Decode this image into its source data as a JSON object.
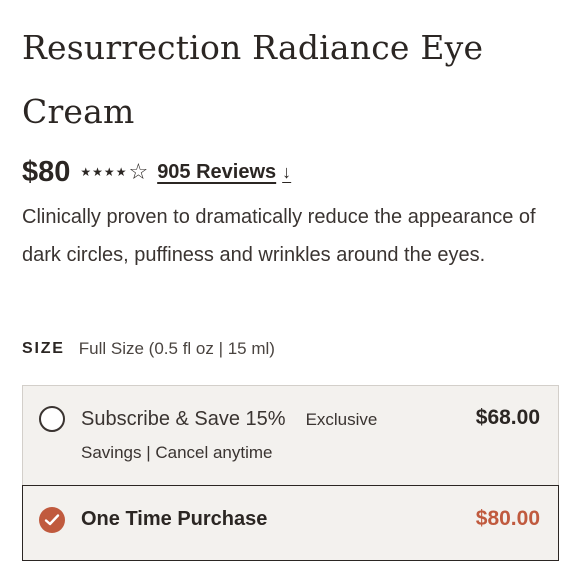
{
  "product": {
    "title": "Resurrection Radiance Eye Cream",
    "price": "$80",
    "rating": 4,
    "rating_max": 5,
    "reviews_label": "905 Reviews",
    "description": "Clinically proven to dramatically reduce the appearance of dark circles, puffiness and wrinkles around the eyes."
  },
  "size": {
    "label": "SIZE",
    "value": "Full Size (0.5 fl oz | 15 ml)"
  },
  "purchase_options": {
    "subscribe": {
      "label": "Subscribe & Save 15%",
      "exclusive": "Exclusive",
      "details": "Savings | Cancel anytime",
      "price": "$68.00",
      "selected": false
    },
    "one_time": {
      "label": "One Time Purchase",
      "price": "$80.00",
      "selected": true
    }
  },
  "icons": {
    "star_filled": "star-icon",
    "star_empty": "star-outline-icon",
    "reviews_arrow": "arrow-down-icon",
    "selected_radio": "check-icon"
  },
  "colors": {
    "text": "#2b2623",
    "accent": "#c05a3e",
    "option_background": "#f3f1ee",
    "selected_border": "#2b2623"
  }
}
